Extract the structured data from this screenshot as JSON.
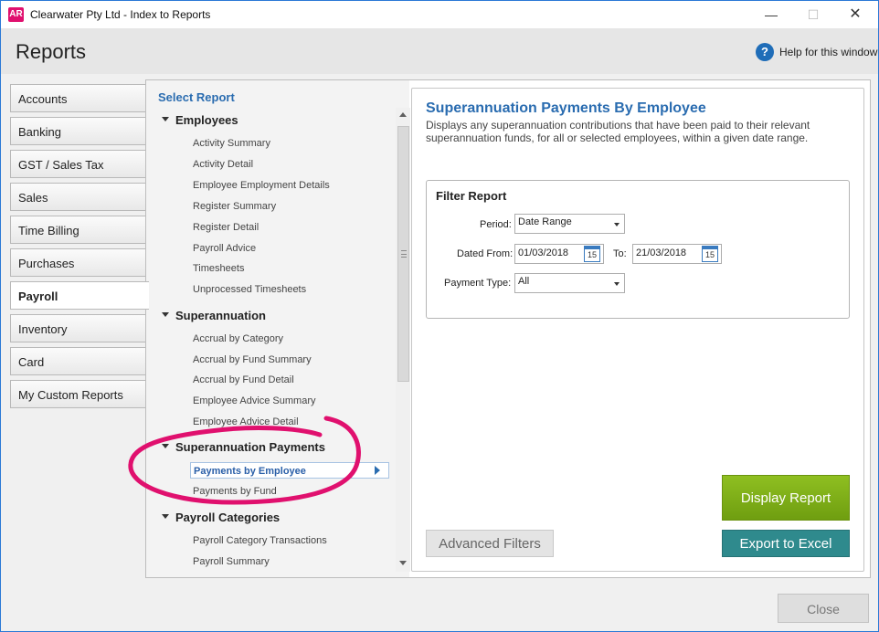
{
  "window": {
    "app_icon": "AR",
    "title": "Clearwater Pty Ltd - Index to Reports"
  },
  "header": {
    "title": "Reports",
    "help_label": "Help for this window"
  },
  "tabs": [
    {
      "label": "Accounts"
    },
    {
      "label": "Banking"
    },
    {
      "label": "GST / Sales Tax"
    },
    {
      "label": "Sales"
    },
    {
      "label": "Time Billing"
    },
    {
      "label": "Purchases"
    },
    {
      "label": "Payroll",
      "active": true
    },
    {
      "label": "Inventory"
    },
    {
      "label": "Card"
    },
    {
      "label": "My Custom Reports"
    }
  ],
  "report_list": {
    "heading": "Select Report",
    "groups": [
      {
        "name": "Employees",
        "items": [
          "Activity Summary",
          "Activity Detail",
          "Employee Employment Details",
          "Register Summary",
          "Register Detail",
          "Payroll Advice",
          "Timesheets",
          "Unprocessed Timesheets"
        ]
      },
      {
        "name": "Superannuation",
        "items": [
          "Accrual by Category",
          "Accrual by Fund Summary",
          "Accrual by Fund Detail",
          "Employee Advice Summary",
          "Employee Advice Detail"
        ]
      },
      {
        "name": "Superannuation Payments",
        "items": [
          "Payments by Employee",
          "Payments by Fund"
        ]
      },
      {
        "name": "Payroll Categories",
        "items": [
          "Payroll Category Transactions",
          "Payroll Summary"
        ]
      }
    ],
    "selected": "Payments by Employee"
  },
  "detail": {
    "title": "Superannuation Payments By Employee",
    "description": "Displays any superannuation contributions that have been paid to their relevant superannuation funds, for all or selected employees, within a given date range.",
    "filter": {
      "title": "Filter Report",
      "period_label": "Period:",
      "period_value": "Date Range",
      "dated_from_label": "Dated From:",
      "dated_from_value": "01/03/2018",
      "to_label": "To:",
      "to_value": "21/03/2018",
      "payment_type_label": "Payment Type:",
      "payment_type_value": "All",
      "calendar_day": "15"
    }
  },
  "buttons": {
    "advanced_filters": "Advanced Filters",
    "display_report": "Display Report",
    "export_excel": "Export to Excel",
    "close": "Close"
  },
  "colors": {
    "accent_blue": "#2a6cb0",
    "display_green": "#7aaa14",
    "export_teal": "#2f8a8d",
    "highlight_pink": "#e0106e"
  }
}
